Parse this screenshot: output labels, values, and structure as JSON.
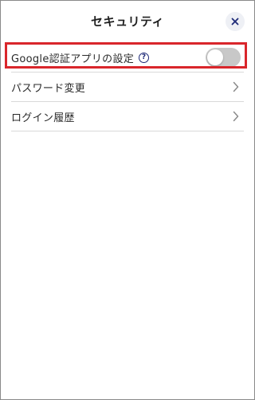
{
  "header": {
    "title": "セキュリティ",
    "close_icon": "close-icon"
  },
  "security": {
    "items": [
      {
        "label": "Google認証アプリの設定",
        "help_icon": "question-circle-icon",
        "control": "toggle",
        "toggle_on": false
      },
      {
        "label": "パスワード変更",
        "control": "chevron-right-icon"
      },
      {
        "label": "ログイン履歴",
        "control": "chevron-right-icon"
      }
    ]
  },
  "colors": {
    "highlight_border": "#d9262b",
    "toggle_off": "#c8c8c8",
    "help_icon": "#1e2a78",
    "close_icon": "#1e2a78"
  }
}
